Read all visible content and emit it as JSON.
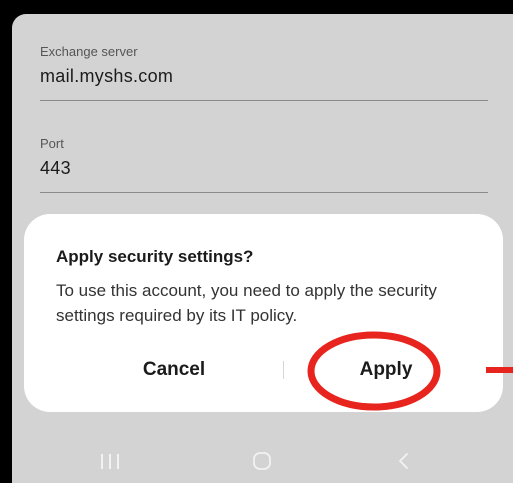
{
  "settings": {
    "exchange_server": {
      "label": "Exchange server",
      "value": "mail.myshs.com"
    },
    "port": {
      "label": "Port",
      "value": "443"
    }
  },
  "dialog": {
    "title": "Apply security settings?",
    "message": "To use this account, you need to apply the security settings required by its IT policy.",
    "cancel_label": "Cancel",
    "apply_label": "Apply"
  },
  "nav_bar": {
    "icons": [
      "recents-icon",
      "home-icon",
      "back-icon"
    ]
  },
  "colors": {
    "screen_background": "#d3d3d3",
    "dialog_background": "#ffffff",
    "annotation": "#e8241e"
  }
}
